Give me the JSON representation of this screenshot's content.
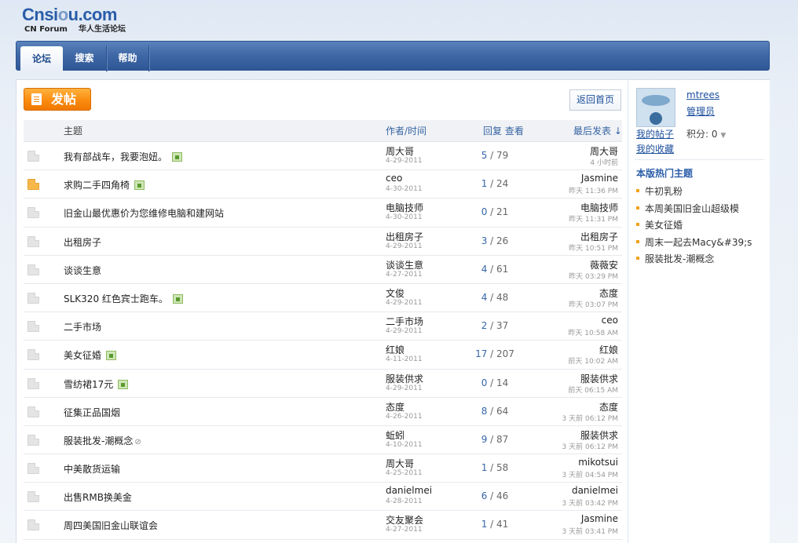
{
  "logo": {
    "main_a": "Cnsi",
    "main_b": "o",
    "main_c": "u.com",
    "sub_en": "CN Forum",
    "sub_cn": "华人生活论坛"
  },
  "nav": {
    "tabs": [
      "论坛",
      "搜索",
      "帮助"
    ]
  },
  "toolbar": {
    "post_label": "发帖",
    "home_label": "返回首页"
  },
  "table": {
    "headers": {
      "subject": "主题",
      "author": "作者/时间",
      "stats": "回复 查看",
      "last": "最后发表 ↓"
    },
    "rows": [
      {
        "title": "我有部战车，我要泡妞。",
        "img": true,
        "author": "周大哥",
        "date": "4-29-2011",
        "replies": "5",
        "views": "79",
        "last_user": "周大哥",
        "last_time": "4 小时前",
        "hot": false
      },
      {
        "title": "求购二手四角椅",
        "img": true,
        "author": "ceo",
        "date": "4-30-2011",
        "replies": "1",
        "views": "24",
        "last_user": "Jasmine",
        "last_time": "昨天 11:36 PM",
        "hot": true
      },
      {
        "title": "旧金山最优惠价为您维修电脑和建网站",
        "img": false,
        "author": "电脑技师",
        "date": "4-30-2011",
        "replies": "0",
        "views": "21",
        "last_user": "电脑技师",
        "last_time": "昨天 11:31 PM",
        "hot": false
      },
      {
        "title": "出租房子",
        "img": false,
        "author": "出租房子",
        "date": "4-29-2011",
        "replies": "3",
        "views": "26",
        "last_user": "出租房子",
        "last_time": "昨天 10:51 PM",
        "hot": false
      },
      {
        "title": "谈谈生意",
        "img": false,
        "author": "谈谈生意",
        "date": "4-27-2011",
        "replies": "4",
        "views": "61",
        "last_user": "薇薇安",
        "last_time": "昨天 03:29 PM",
        "hot": false
      },
      {
        "title": "SLK320 红色宾士跑车。",
        "img": true,
        "author": "文俊",
        "date": "4-29-2011",
        "replies": "4",
        "views": "48",
        "last_user": "态度",
        "last_time": "昨天 03:07 PM",
        "hot": false
      },
      {
        "title": "二手市场",
        "img": false,
        "author": "二手市场",
        "date": "4-29-2011",
        "replies": "2",
        "views": "37",
        "last_user": "ceo",
        "last_time": "昨天 10:58 AM",
        "hot": false
      },
      {
        "title": "美女征婚",
        "img": true,
        "author": "红娘",
        "date": "4-11-2011",
        "replies": "17",
        "views": "207",
        "last_user": "红娘",
        "last_time": "前天 10:02 AM",
        "hot": false
      },
      {
        "title": "雪纺裙17元",
        "img": true,
        "author": "服装供求",
        "date": "4-29-2011",
        "replies": "0",
        "views": "14",
        "last_user": "服装供求",
        "last_time": "前天 06:15 AM",
        "hot": false
      },
      {
        "title": "征集正品国烟",
        "img": false,
        "author": "态度",
        "date": "4-26-2011",
        "replies": "8",
        "views": "64",
        "last_user": "态度",
        "last_time": "3 天前 06:12 PM",
        "hot": false
      },
      {
        "title": "服装批发-潮概念",
        "img": false,
        "clip": true,
        "author": "蚯蚓",
        "date": "4-10-2011",
        "replies": "9",
        "views": "87",
        "last_user": "服装供求",
        "last_time": "3 天前 06:12 PM",
        "hot": false
      },
      {
        "title": "中美散货运输",
        "img": false,
        "author": "周大哥",
        "date": "4-25-2011",
        "replies": "1",
        "views": "58",
        "last_user": "mikotsui",
        "last_time": "3 天前 04:54 PM",
        "hot": false
      },
      {
        "title": "出售RMB换美金",
        "img": false,
        "author": "danielmei",
        "date": "4-28-2011",
        "replies": "6",
        "views": "46",
        "last_user": "danielmei",
        "last_time": "3 天前 03:42 PM",
        "hot": false
      },
      {
        "title": "周四美国旧金山联谊会",
        "img": false,
        "author": "交友聚会",
        "date": "4-27-2011",
        "replies": "1",
        "views": "41",
        "last_user": "Jasmine",
        "last_time": "3 天前 03:41 PM",
        "hot": false
      }
    ]
  },
  "sidebar": {
    "username": "mtrees",
    "role": "管理员",
    "my_posts": "我的帖子",
    "my_favorites": "我的收藏",
    "points_label": "积分: 0",
    "hot_title": "本版热门主题",
    "hot_topics": [
      "牛初乳粉",
      "本周美国旧金山超级模",
      "美女征婚",
      "周末一起去Macy&#39;s",
      "服装批发-潮概念"
    ]
  }
}
